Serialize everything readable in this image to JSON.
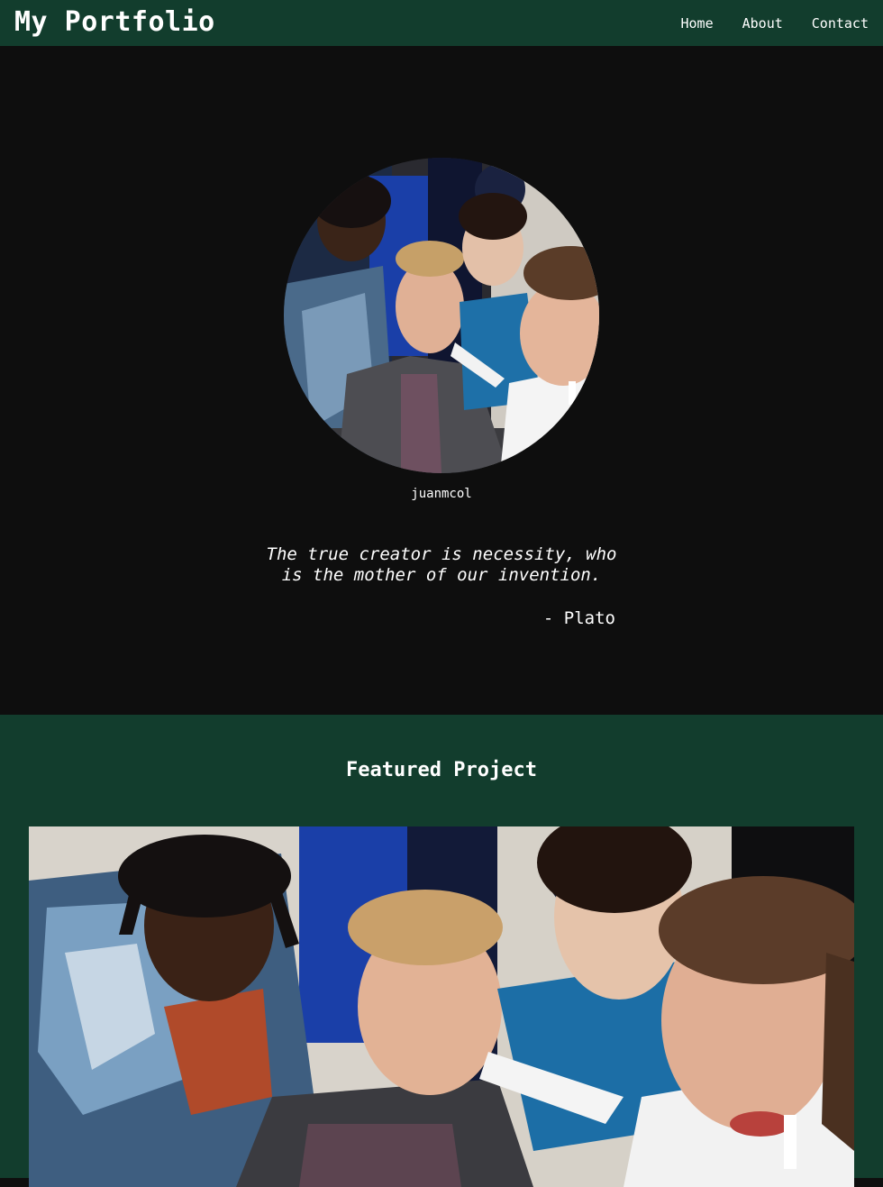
{
  "navbar": {
    "brand": "My Portfolio",
    "links": [
      "Home",
      "About",
      "Contact"
    ]
  },
  "hero": {
    "username": "juanmcol",
    "quote_line1": "The true creator is necessity, who",
    "quote_line2": "is the mother of our invention.",
    "quote_author": "- Plato",
    "avatar_image": "group-photo-four-people"
  },
  "featured": {
    "title": "Featured Project",
    "image": "group-photo-four-people"
  },
  "colors": {
    "nav_background": "#123d2d",
    "hero_background": "#0e0e0e",
    "featured_background": "#123d2d",
    "text": "#ffffff"
  }
}
